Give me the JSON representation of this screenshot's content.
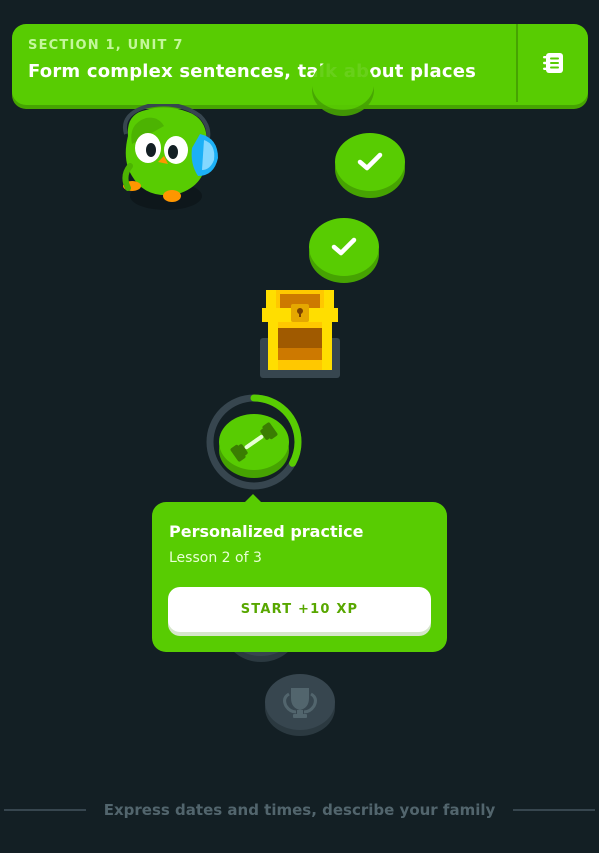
{
  "header": {
    "section_label": "SECTION 1, UNIT 7",
    "unit_title": "Form complex sentences, talk about places",
    "guidebook_icon": "notebook-icon"
  },
  "path": {
    "completed_icon": "checkmark-icon",
    "treasure_icon": "treasure-chest-icon",
    "current_icon": "dumbbell-icon",
    "locked_icon": "trophy-icon",
    "current_progress": 0.33
  },
  "popover": {
    "title": "Personalized practice",
    "subtitle": "Lesson 2 of 3",
    "button_label": "START +10 XP"
  },
  "next_unit": {
    "label": "Express dates and times, describe your family"
  },
  "colors": {
    "background": "#131f24",
    "accent": "#58cc02",
    "accent_shadow": "#46a302",
    "locked": "#37464f"
  }
}
